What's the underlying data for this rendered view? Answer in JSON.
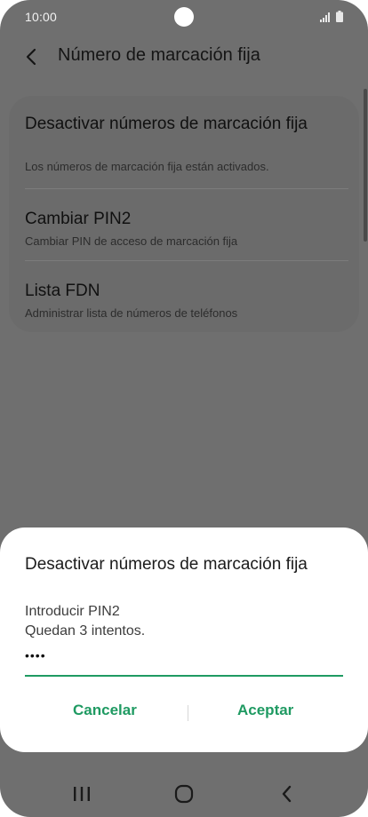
{
  "status_bar": {
    "time": "10:00",
    "icons": [
      "signal-icon",
      "battery-icon"
    ]
  },
  "app_bar": {
    "back_icon": "back-arrow-icon",
    "title": "Número de marcación fija"
  },
  "settings": {
    "items": [
      {
        "title": "Desactivar números de marcación fija",
        "subtitle": "Los números de marcación fija están activados."
      },
      {
        "title": "Cambiar PIN2",
        "subtitle": "Cambiar PIN de acceso de marcación fija"
      },
      {
        "title": "Lista FDN",
        "subtitle": "Administrar lista de números de teléfonos"
      }
    ]
  },
  "dialog": {
    "title": "Desactivar números de marcación fija",
    "prompt": "Introducir PIN2",
    "attempts": "Quedan 3 intentos.",
    "pin_value": "••••",
    "cancel_label": "Cancelar",
    "accept_label": "Aceptar"
  },
  "nav_bar": {
    "icons": [
      "recent-apps-icon",
      "home-icon",
      "back-icon"
    ]
  },
  "colors": {
    "accent": "#1f9a62",
    "dim_background": "#6f6f6f",
    "dialog_background": "#ffffff"
  }
}
